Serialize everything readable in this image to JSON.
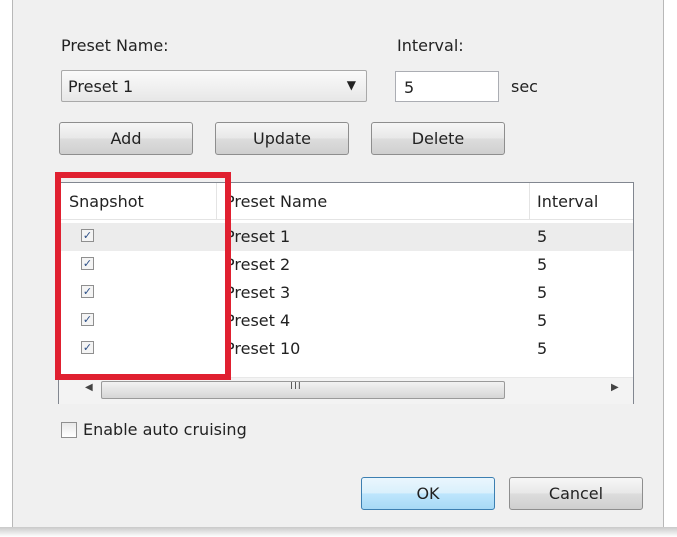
{
  "form": {
    "preset_name_label": "Preset Name:",
    "interval_label": "Interval:",
    "preset_select_value": "Preset 1",
    "interval_value": "5",
    "interval_unit": "sec"
  },
  "actions": {
    "add": "Add",
    "update": "Update",
    "delete": "Delete"
  },
  "table": {
    "columns": [
      "Snapshot",
      "Preset Name",
      "Interval"
    ],
    "rows": [
      {
        "snapshot": true,
        "name": "Preset 1",
        "interval": "5"
      },
      {
        "snapshot": true,
        "name": "Preset 2",
        "interval": "5"
      },
      {
        "snapshot": true,
        "name": "Preset 3",
        "interval": "5"
      },
      {
        "snapshot": true,
        "name": "Preset 4",
        "interval": "5"
      },
      {
        "snapshot": true,
        "name": "Preset 10",
        "interval": "5"
      }
    ],
    "scroll_grip": "III"
  },
  "options": {
    "auto_cruising_label": "Enable auto cruising",
    "auto_cruising_checked": false
  },
  "footer": {
    "ok": "OK",
    "cancel": "Cancel"
  },
  "colors": {
    "highlight": "#e02030",
    "dialog_bg": "#f0f0f0"
  }
}
